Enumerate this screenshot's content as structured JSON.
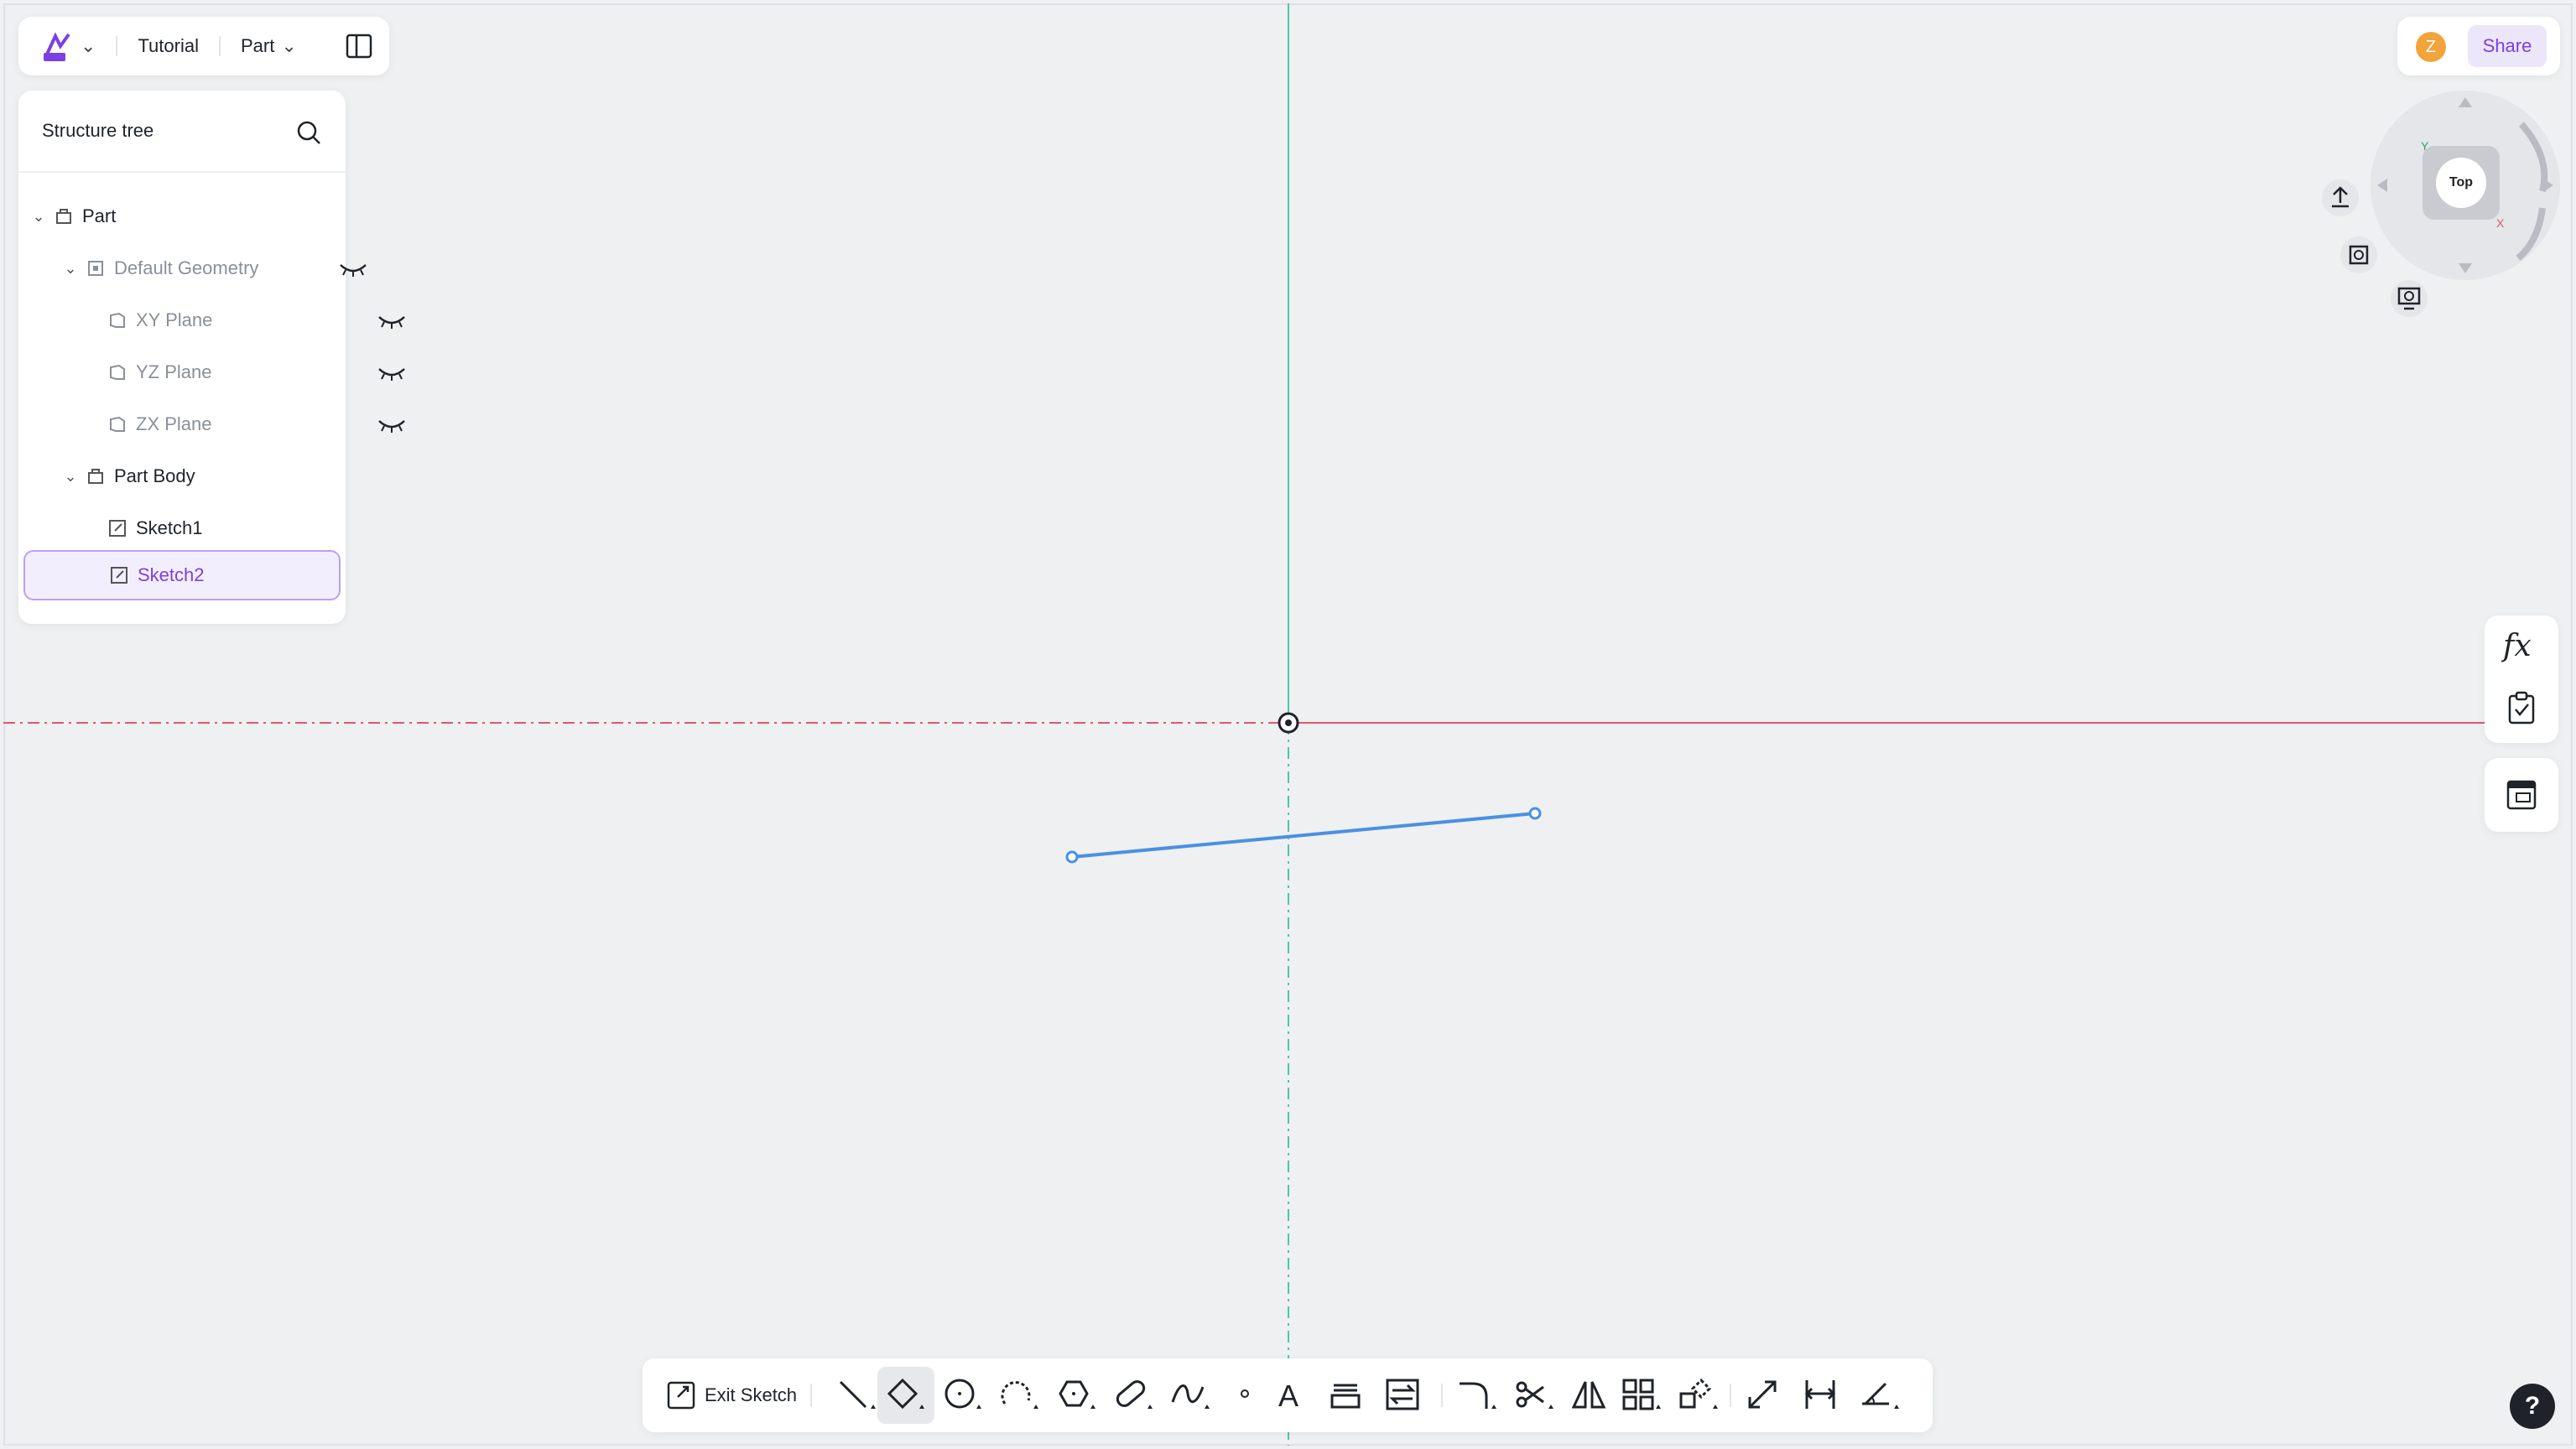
{
  "header": {
    "project": "Tutorial",
    "mode": "Part"
  },
  "tree": {
    "title": "Structure tree",
    "items": [
      {
        "label": "Part"
      },
      {
        "label": "Default Geometry"
      },
      {
        "label": "XY Plane"
      },
      {
        "label": "YZ Plane"
      },
      {
        "label": "ZX Plane"
      },
      {
        "label": "Part Body"
      },
      {
        "label": "Sketch1"
      },
      {
        "label": "Sketch2"
      }
    ]
  },
  "user": {
    "avatar_letter": "Z",
    "share_label": "Share"
  },
  "viewcube": {
    "face": "Top",
    "axis_y": "Y",
    "axis_x": "X"
  },
  "side_tools": {
    "fx_label": "fx"
  },
  "toolbar": {
    "exit_label": "Exit Sketch",
    "text_tool": "A"
  },
  "help": {
    "label": "?"
  },
  "colors": {
    "accent": "#7b3fe4",
    "x_axis": "#e0566f",
    "y_axis": "#4fc6a8",
    "sketch_line": "#4a90e2"
  },
  "icons": [
    "logo-icon",
    "chevron-down-icon",
    "split-view-icon",
    "search-icon",
    "eye-closed-icon",
    "part-icon",
    "geometry-icon",
    "plane-icon",
    "body-icon",
    "sketch-icon",
    "fx-icon",
    "checklist-icon",
    "table-icon",
    "line-icon",
    "rectangle-icon",
    "circle-icon",
    "arc-icon",
    "polygon-icon",
    "slot-icon",
    "spline-icon",
    "point-icon",
    "text-icon",
    "offset-icon",
    "convert-icon",
    "fillet-icon",
    "trim-icon",
    "mirror-icon",
    "pattern-icon",
    "transform-icon",
    "dimension-icon",
    "constraint-icon",
    "help-icon"
  ]
}
